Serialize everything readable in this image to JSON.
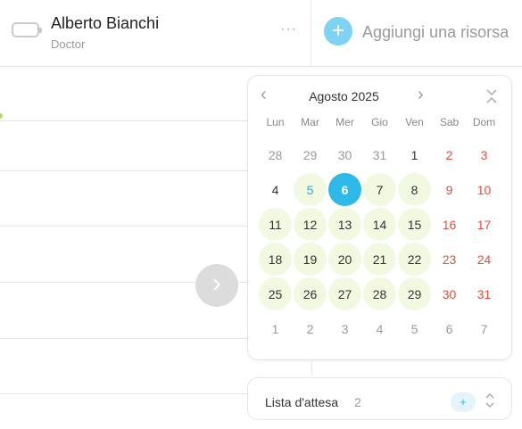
{
  "resource": {
    "name": "Alberto Bianchi",
    "role": "Doctor",
    "more": "···"
  },
  "add_resource": {
    "icon": "+",
    "label": "Aggiungi una risorsa"
  },
  "calendar": {
    "title": "Agosto 2025",
    "prev": "‹",
    "next": "›",
    "weekdays": [
      "Lun",
      "Mar",
      "Mer",
      "Gio",
      "Ven",
      "Sab",
      "Dom"
    ],
    "days": [
      {
        "d": "28",
        "other": true
      },
      {
        "d": "29",
        "other": true
      },
      {
        "d": "30",
        "other": true
      },
      {
        "d": "31",
        "other": true
      },
      {
        "d": "1"
      },
      {
        "d": "2",
        "weekend": true
      },
      {
        "d": "3",
        "weekend": true
      },
      {
        "d": "4"
      },
      {
        "d": "5",
        "avail": true,
        "today": true
      },
      {
        "d": "6",
        "selected": true
      },
      {
        "d": "7",
        "avail": true
      },
      {
        "d": "8",
        "avail": true
      },
      {
        "d": "9",
        "weekend": true
      },
      {
        "d": "10",
        "weekend": true
      },
      {
        "d": "11",
        "avail": true
      },
      {
        "d": "12",
        "avail": true
      },
      {
        "d": "13",
        "avail": true
      },
      {
        "d": "14",
        "avail": true
      },
      {
        "d": "15",
        "avail": true
      },
      {
        "d": "16",
        "weekend": true
      },
      {
        "d": "17",
        "weekend": true
      },
      {
        "d": "18",
        "avail": true
      },
      {
        "d": "19",
        "avail": true
      },
      {
        "d": "20",
        "avail": true
      },
      {
        "d": "21",
        "avail": true
      },
      {
        "d": "22",
        "avail": true
      },
      {
        "d": "23",
        "weekend": true
      },
      {
        "d": "24",
        "weekend": true
      },
      {
        "d": "25",
        "avail": true
      },
      {
        "d": "26",
        "avail": true
      },
      {
        "d": "27",
        "avail": true
      },
      {
        "d": "28",
        "avail": true
      },
      {
        "d": "29",
        "avail": true
      },
      {
        "d": "30",
        "weekend": true
      },
      {
        "d": "31",
        "weekend": true
      },
      {
        "d": "1",
        "other": true
      },
      {
        "d": "2",
        "other": true
      },
      {
        "d": "3",
        "other": true
      },
      {
        "d": "4",
        "other": true
      },
      {
        "d": "5",
        "other": true
      },
      {
        "d": "6",
        "other": true
      },
      {
        "d": "7",
        "other": true
      }
    ]
  },
  "waiting_list": {
    "label": "Lista d'attesa",
    "count": "2",
    "add": "+"
  },
  "nav": {
    "next": "›"
  },
  "colors": {
    "accent": "#2ebae9",
    "available_day": "#f2f9e1",
    "weekend": "#e74c3c"
  }
}
